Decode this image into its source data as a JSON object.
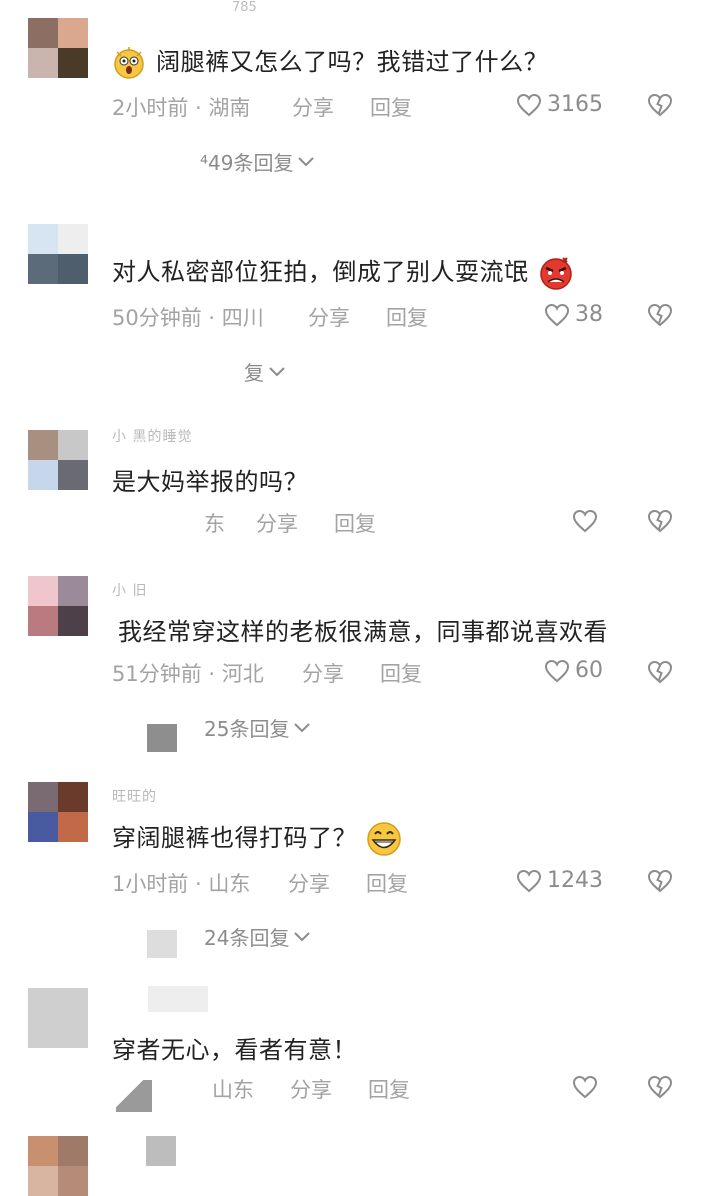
{
  "top_fragment": "785",
  "comments": [
    {
      "avatar": [
        "#8a6f62",
        "#d9a88e",
        "#c9b5ad",
        "#4a3a28"
      ],
      "username": "",
      "text": "阔腿裤又怎么了吗？我错过了什么？",
      "emoji": "surprised-face",
      "time_loc": "2小时前 · 湖南",
      "share": "分享",
      "reply": "回复",
      "likes": "3165",
      "replies_label": "⁴49条回复"
    },
    {
      "avatar": [
        "#d7e4f2",
        "#eeeeee",
        "#5b6b79",
        "#4e5e6c"
      ],
      "username": "",
      "text": "对人私密部位狂拍，倒成了别人耍流氓",
      "emoji": "angry-face",
      "time_loc": "50分钟前 · 四川",
      "share": "分享",
      "reply": "回复",
      "likes": "38",
      "replies_label": "复"
    },
    {
      "avatar": [
        "#a89080",
        "#c8c8c8",
        "#c6d7ec",
        "#6a6a72"
      ],
      "username": "小 黑的睡觉",
      "text": "是大妈举报的吗？",
      "emoji": "",
      "time_loc": "东",
      "share": "分享",
      "reply": "回复",
      "likes": "",
      "replies_label": ""
    },
    {
      "avatar": [
        "#eec6cc",
        "#9a8a9a",
        "#b97a80",
        "#4d4048"
      ],
      "username": "小 旧",
      "text": "我经常穿这样的老板很满意，同事都说喜欢看",
      "emoji": "",
      "time_loc": "51分钟前 · 河北",
      "share": "分享",
      "reply": "回复",
      "likes": "60",
      "replies_label": "25条回复"
    },
    {
      "avatar": [
        "#7a6a72",
        "#6a3a2a",
        "#4a5aa0",
        "#c26a48"
      ],
      "username": "旺旺的",
      "text": "穿阔腿裤也得打码了？",
      "emoji": "grinning-face",
      "time_loc": "1小时前 · 山东",
      "share": "分享",
      "reply": "回复",
      "likes": "1243",
      "replies_label": "24条回复"
    },
    {
      "avatar": [
        "#cfcfcf",
        "#cfcfcf",
        "#cfcfcf",
        "#cfcfcf"
      ],
      "username": "",
      "text": "穿者无心，看者有意！",
      "emoji": "",
      "time_loc": "山东",
      "share": "分享",
      "reply": "回复",
      "likes": "",
      "replies_label": ""
    },
    {
      "avatar": [
        "#c8906e",
        "#a07a68",
        "#d7b5a0",
        "#b58c77"
      ],
      "username": "",
      "text": "",
      "emoji": "",
      "time_loc": "",
      "share": "",
      "reply": "",
      "likes": "",
      "replies_label": ""
    }
  ],
  "colors": {
    "meta": "#a3a3a3",
    "text": "#222222",
    "icon": "#8c8c8c"
  },
  "icons": {
    "like": "heart-outline-icon",
    "dislike": "broken-heart-icon",
    "expand": "chevron-down-icon"
  }
}
